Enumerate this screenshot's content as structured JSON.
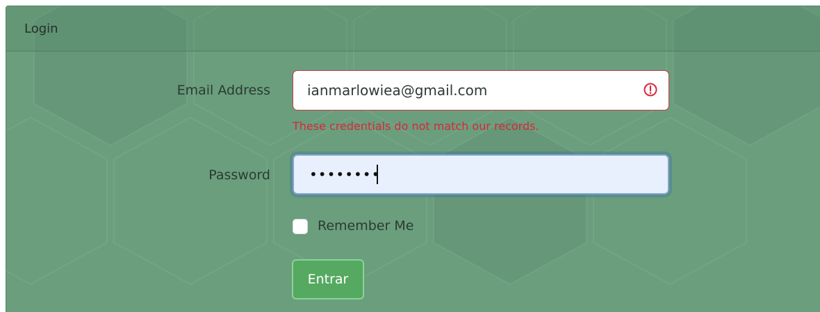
{
  "header": {
    "title": "Login"
  },
  "form": {
    "email": {
      "label": "Email Address",
      "value": "ianmarlowiea@gmail.com",
      "error": "These credentials do not match our records."
    },
    "password": {
      "label": "Password",
      "masked_value": "••••••••"
    },
    "remember": {
      "label": "Remember Me",
      "checked": false
    },
    "submit_label": "Entrar"
  },
  "icons": {
    "email_error": "exclamation-circle-icon"
  },
  "colors": {
    "card_background": "#6a9e7d",
    "error": "#d7283a",
    "button": "#55a960",
    "password_field_background": "#e8f0fe"
  }
}
